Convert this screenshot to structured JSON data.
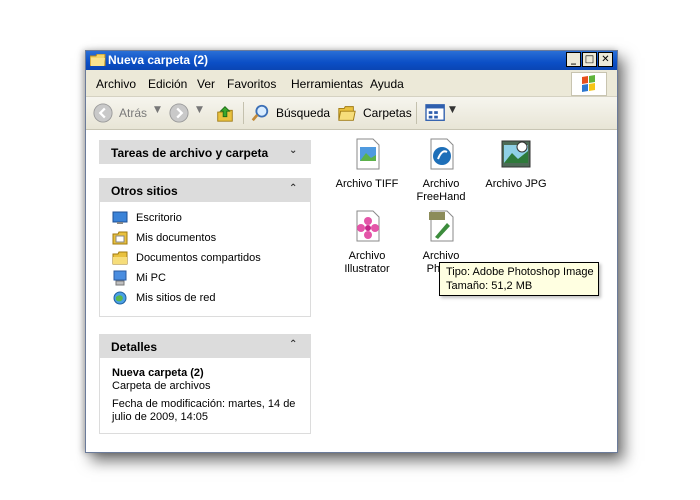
{
  "window": {
    "title": "Nueva carpeta (2)",
    "buttons": {
      "minimize": "_",
      "maximize": "□",
      "close": "✕"
    }
  },
  "menubar": {
    "items": [
      "Archivo",
      "Edición",
      "Ver",
      "Favoritos",
      "Herramientas",
      "Ayuda"
    ]
  },
  "toolbar": {
    "back_label": "Atrás",
    "search_label": "Búsqueda",
    "folders_label": "Carpetas"
  },
  "left_pane": {
    "tasks": {
      "title": "Tareas de archivo y carpeta"
    },
    "other_places": {
      "title": "Otros sitios",
      "links": [
        "Escritorio",
        "Mis documentos",
        "Documentos compartidos",
        "Mi PC",
        "Mis sitios de red"
      ]
    },
    "details": {
      "title": "Detalles",
      "name": "Nueva carpeta (2)",
      "type": "Carpeta de archivos",
      "modified_line1": "Fecha de modificación: martes, 14 de",
      "modified_line2": "julio de 2009, 14:05"
    }
  },
  "files": [
    {
      "line1": "Archivo TIFF",
      "line2": ""
    },
    {
      "line1": "Archivo",
      "line2": "FreeHand"
    },
    {
      "line1": "Archivo JPG",
      "line2": ""
    },
    {
      "line1": "Archivo",
      "line2": "Illustrator"
    },
    {
      "line1": "Archivo",
      "line2": "Photo"
    }
  ],
  "tooltip": {
    "line1": "Tipo: Adobe Photoshop Image",
    "line2": "Tamaño: 51,2 MB"
  }
}
